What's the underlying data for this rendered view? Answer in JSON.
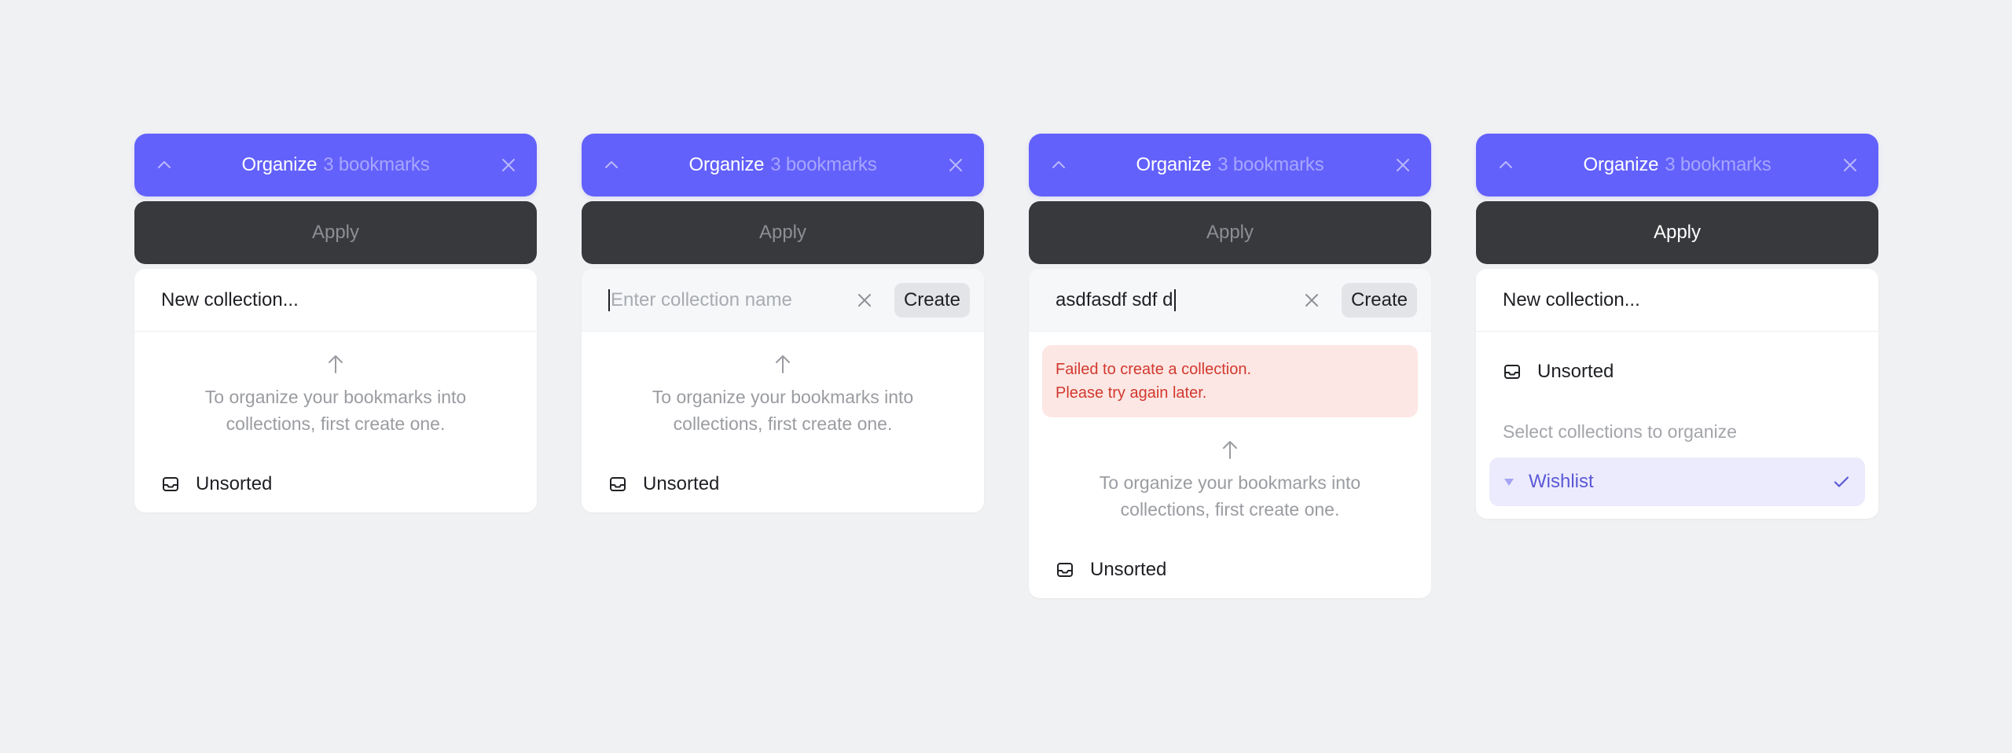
{
  "colors": {
    "accent": "#6361fb",
    "header_count": "#a7a6ff",
    "apply_bg": "#38393d",
    "error_bg": "#fde7e4",
    "error_text": "#d1392f",
    "selected_bg": "#ecebfd"
  },
  "header": {
    "title": "Organize",
    "count": "3 bookmarks",
    "collapse_icon": "chevron-up-icon",
    "close_icon": "close-icon"
  },
  "apply_label": "Apply",
  "new_collection_label": "New collection...",
  "input": {
    "placeholder": "Enter collection name",
    "typed_value": "asdfasdf sdf d",
    "create_label": "Create"
  },
  "hint": {
    "icon": "arrow-up-icon",
    "line1": "To organize your bookmarks into",
    "line2": "collections, first create one."
  },
  "error": {
    "line1": "Failed to create a collection.",
    "line2": "Please try again later."
  },
  "unsorted_label": "Unsorted",
  "select_label": "Select collections to organize",
  "wishlist": {
    "label": "Wishlist",
    "selected": true
  }
}
